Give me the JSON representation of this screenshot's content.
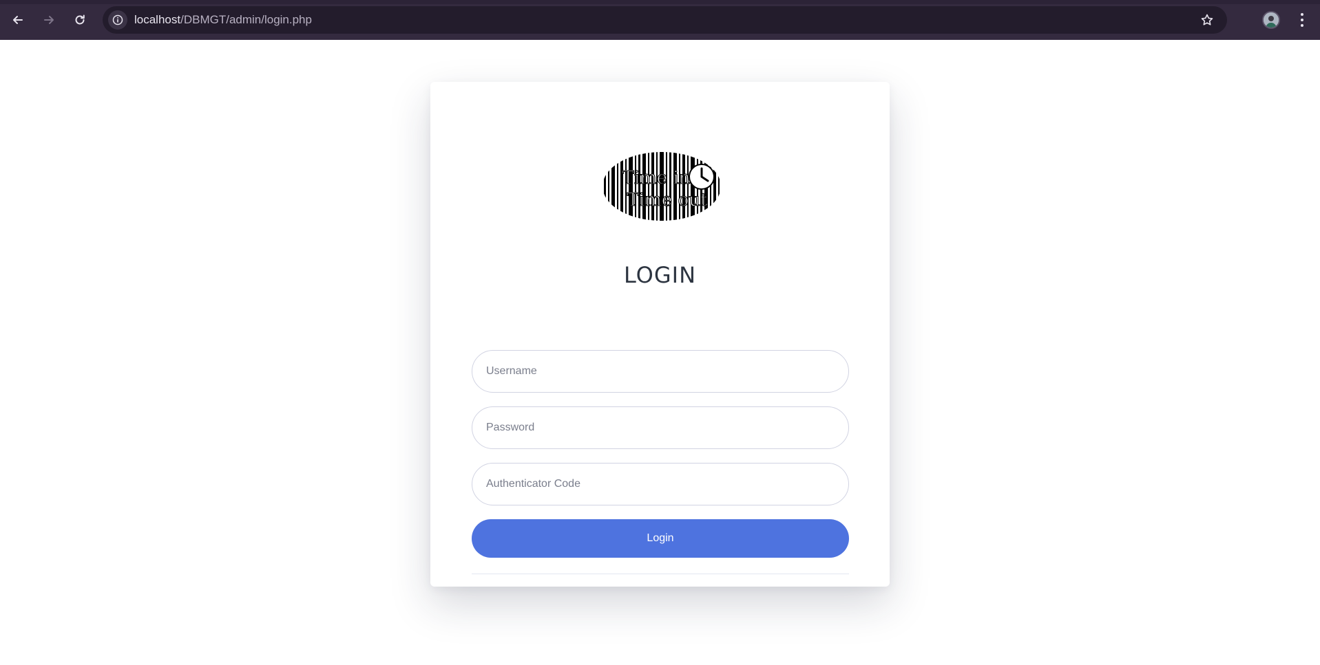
{
  "browser": {
    "url_host": "localhost",
    "url_path": "/DBMGT/admin/login.php",
    "icons": {
      "back": "back-arrow-icon",
      "forward": "forward-arrow-icon",
      "reload": "reload-icon",
      "site_info": "info-icon",
      "bookmark": "star-icon",
      "profile": "avatar",
      "menu": "kebab-menu-icon"
    },
    "colors": {
      "frame": "#342a3f",
      "omnibox": "#231c2c"
    }
  },
  "login": {
    "logo_text_line1": "Time in",
    "logo_text_line2": "Time out",
    "title": "LOGIN",
    "username_placeholder": "Username",
    "password_placeholder": "Password",
    "authenticator_placeholder": "Authenticator Code",
    "submit_label": "Login",
    "colors": {
      "button": "#4e73df",
      "field_border": "#d1d3e2"
    }
  }
}
